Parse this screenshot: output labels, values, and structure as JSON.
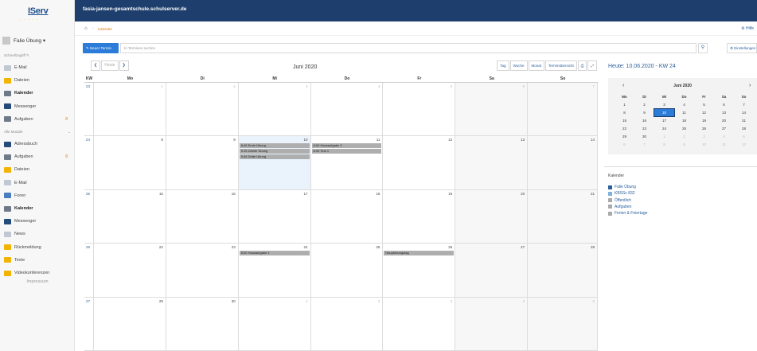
{
  "app": {
    "logo_text": "IServ",
    "logo_dots": "· · · · ·",
    "domain": "fasia-jansen-gesamtschule.schulserver.de"
  },
  "user": {
    "name": "Falie Übung ▾"
  },
  "sidebar": {
    "fav_header": "Schnellzugriff ✎",
    "fav_items": [
      {
        "label": "E-Mail",
        "icon": "mail-icon",
        "color": "#c0c8d4"
      },
      {
        "label": "Dateien",
        "icon": "folder-icon",
        "color": "#f2b400"
      },
      {
        "label": "Kalender",
        "icon": "calendar-icon",
        "color": "#6e7a88",
        "bold": true
      },
      {
        "label": "Messenger",
        "icon": "messenger-icon",
        "color": "#244b7a"
      },
      {
        "label": "Aufgaben",
        "icon": "tasks-icon",
        "color": "#6e7a88",
        "badge": "8"
      }
    ],
    "all_header": "Alle Module",
    "all_chevron": "⌄",
    "all_items": [
      {
        "label": "Adressbuch",
        "icon": "addressbook-icon",
        "color": "#244b7a"
      },
      {
        "label": "Aufgaben",
        "icon": "tasks-icon",
        "color": "#6e7a88",
        "badge": "8"
      },
      {
        "label": "Dateien",
        "icon": "folder-icon",
        "color": "#f2b400"
      },
      {
        "label": "E-Mail",
        "icon": "mail-icon",
        "color": "#c0c8d4"
      },
      {
        "label": "Foren",
        "icon": "forum-icon",
        "color": "#4a7cc0"
      },
      {
        "label": "Kalender",
        "icon": "calendar-icon",
        "color": "#6e7a88",
        "bold": true
      },
      {
        "label": "Messenger",
        "icon": "messenger-icon",
        "color": "#244b7a"
      },
      {
        "label": "News",
        "icon": "news-icon",
        "color": "#c0c8d4"
      },
      {
        "label": "Rückmeldung",
        "icon": "feedback-icon",
        "color": "#f2b400"
      },
      {
        "label": "Texte",
        "icon": "texts-icon",
        "color": "#f2b400"
      },
      {
        "label": "Videokonferenzen",
        "icon": "video-icon",
        "color": "#f2b400"
      }
    ],
    "impressum": "Impressum"
  },
  "breadcrumb": {
    "home": "⌂",
    "sep": "›",
    "current": "Kalender",
    "help": "⚙ Hilfe"
  },
  "toolbar": {
    "new_event": "✎ Neuer Termin",
    "search_placeholder": "In Terminen suchen",
    "search_icon": "⚲",
    "settings": "⚙ Einstellungen"
  },
  "calendar": {
    "nav_prev": "❮",
    "nav_today": "Heute",
    "nav_next": "❯",
    "month": "Juni 2020",
    "views": [
      "Tag",
      "Woche",
      "Monat",
      "Terminübersicht",
      "⎙",
      "⤢"
    ],
    "headers": [
      "KW",
      "Mo",
      "Di",
      "Mi",
      "Do",
      "Fr",
      "Sa",
      "So"
    ],
    "weeks": [
      {
        "kw": "23",
        "days": [
          {
            "n": "1",
            "o": true
          },
          {
            "n": "2",
            "o": true
          },
          {
            "n": "3",
            "o": true
          },
          {
            "n": "4",
            "o": true
          },
          {
            "n": "5",
            "o": true
          },
          {
            "n": "6",
            "o": true,
            "we": true
          },
          {
            "n": "7",
            "o": true,
            "we": true
          }
        ]
      },
      {
        "kw": "24",
        "days": [
          {
            "n": "8"
          },
          {
            "n": "9"
          },
          {
            "n": "10",
            "today": true,
            "events": [
              "8:45 Erste Übung",
              "9:15 Zweite Übung",
              "9:45 Dritte Übung"
            ]
          },
          {
            "n": "11",
            "events": [
              "8:00 Hausaufgabe 2",
              "8:30 Test 1"
            ]
          },
          {
            "n": "12"
          },
          {
            "n": "13",
            "we": true
          },
          {
            "n": "14",
            "we": true
          }
        ]
      },
      {
        "kw": "25",
        "days": [
          {
            "n": "15"
          },
          {
            "n": "16"
          },
          {
            "n": "17"
          },
          {
            "n": "18"
          },
          {
            "n": "19"
          },
          {
            "n": "20",
            "we": true
          },
          {
            "n": "21",
            "we": true
          }
        ]
      },
      {
        "kw": "26",
        "days": [
          {
            "n": "22"
          },
          {
            "n": "23"
          },
          {
            "n": "24",
            "events": [
              "8:30 Hausaufgabe 1"
            ]
          },
          {
            "n": "25"
          },
          {
            "n": "26",
            "events": [
              "Hauptübungstag"
            ]
          },
          {
            "n": "27",
            "we": true
          },
          {
            "n": "28",
            "we": true
          }
        ]
      },
      {
        "kw": "27",
        "days": [
          {
            "n": "29"
          },
          {
            "n": "30"
          },
          {
            "n": "1",
            "o": true
          },
          {
            "n": "2",
            "o": true
          },
          {
            "n": "3",
            "o": true
          },
          {
            "n": "4",
            "o": true,
            "we": true
          },
          {
            "n": "5",
            "o": true,
            "we": true
          }
        ]
      }
    ]
  },
  "right": {
    "date_heading": "Heute: 10.06.2020 - KW 24",
    "mini": {
      "prev": "‹",
      "next": "›",
      "title": "Juni 2020",
      "headers": [
        "Mo",
        "Di",
        "Mi",
        "Do",
        "Fr",
        "Sa",
        "So"
      ],
      "rows": [
        [
          {
            "n": "1"
          },
          {
            "n": "2"
          },
          {
            "n": "3"
          },
          {
            "n": "4"
          },
          {
            "n": "5"
          },
          {
            "n": "6"
          },
          {
            "n": "7"
          }
        ],
        [
          {
            "n": "8"
          },
          {
            "n": "9"
          },
          {
            "n": "10",
            "sel": true
          },
          {
            "n": "11"
          },
          {
            "n": "12"
          },
          {
            "n": "13"
          },
          {
            "n": "14"
          }
        ],
        [
          {
            "n": "15"
          },
          {
            "n": "16"
          },
          {
            "n": "17"
          },
          {
            "n": "18"
          },
          {
            "n": "19"
          },
          {
            "n": "20"
          },
          {
            "n": "21"
          }
        ],
        [
          {
            "n": "22"
          },
          {
            "n": "23"
          },
          {
            "n": "24"
          },
          {
            "n": "25"
          },
          {
            "n": "26"
          },
          {
            "n": "27"
          },
          {
            "n": "28"
          }
        ],
        [
          {
            "n": "29"
          },
          {
            "n": "30"
          },
          {
            "n": "1",
            "o": true
          },
          {
            "n": "2",
            "o": true
          },
          {
            "n": "3",
            "o": true
          },
          {
            "n": "4",
            "o": true
          },
          {
            "n": "5",
            "o": true
          }
        ],
        [
          {
            "n": "6",
            "o": true
          },
          {
            "n": "7",
            "o": true
          },
          {
            "n": "8",
            "o": true
          },
          {
            "n": "9",
            "o": true
          },
          {
            "n": "10",
            "o": true
          },
          {
            "n": "11",
            "o": true
          },
          {
            "n": "12",
            "o": true
          }
        ]
      ]
    },
    "kal_header": "Kalender",
    "kal_items": [
      {
        "label": "Falie Übung",
        "color": "#2a5f9e"
      },
      {
        "label": "KBSSc 832",
        "color": "#7fb0de"
      },
      {
        "label": "Öffentlich",
        "color": "#aaaaaa"
      },
      {
        "label": "Aufgaben",
        "color": "#aaaaaa"
      },
      {
        "label": "Ferien & Feiertage",
        "color": "#aaaaaa"
      }
    ]
  }
}
